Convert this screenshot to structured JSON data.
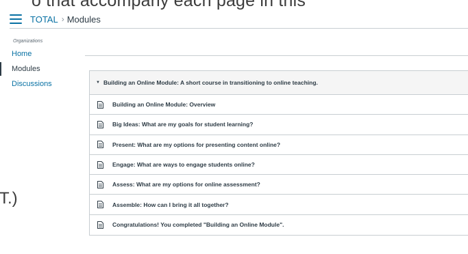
{
  "background": {
    "top_text": "o that accompany each page in this",
    "left_text": "T.)"
  },
  "header": {
    "menu_icon": "hamburger-menu-icon",
    "breadcrumb_root": "TOTAL",
    "breadcrumb_separator": "›",
    "breadcrumb_current": "Modules"
  },
  "nav": {
    "heading": "Organizations",
    "items": [
      {
        "label": "Home",
        "active": false
      },
      {
        "label": "Modules",
        "active": true
      },
      {
        "label": "Discussions",
        "active": false
      }
    ]
  },
  "module": {
    "caret_icon": "triangle-down-icon",
    "title": "Building an Online Module: A short course in transitioning to online teaching.",
    "items": [
      {
        "icon": "page-icon",
        "title": "Building an Online Module: Overview"
      },
      {
        "icon": "page-icon",
        "title": "Big Ideas: What are my goals for student learning?"
      },
      {
        "icon": "page-icon",
        "title": "Present: What are my options for presenting content online?"
      },
      {
        "icon": "page-icon",
        "title": "Engage: What are ways to engage students online?"
      },
      {
        "icon": "page-icon",
        "title": "Assess: What are my options for online assessment?"
      },
      {
        "icon": "page-icon",
        "title": "Assemble: How can I bring it all together?"
      },
      {
        "icon": "page-icon",
        "title": "Congratulations! You completed \"Building an Online Module\"."
      }
    ]
  },
  "colors": {
    "link": "#0770a3",
    "text": "#2d3b45",
    "border": "#c7cdd1",
    "module_header_bg": "#f5f5f5"
  }
}
